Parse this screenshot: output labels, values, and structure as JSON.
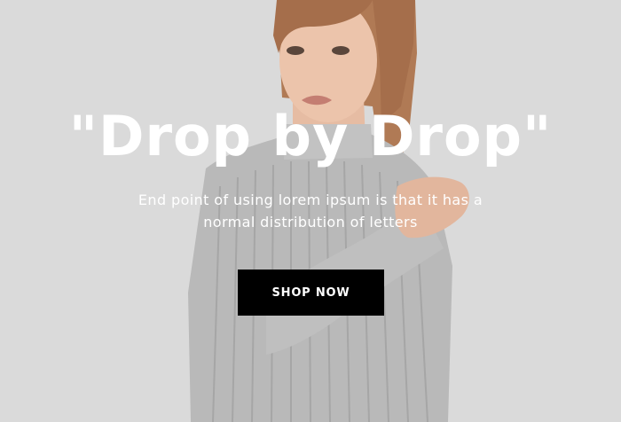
{
  "hero": {
    "title": "\"Drop by Drop\"",
    "subtitle": "End point of using lorem ipsum is that it has a normal distribution of letters",
    "cta_label": "SHOP NOW"
  },
  "colors": {
    "background": "#dadada",
    "text": "#ffffff",
    "button_bg": "#000000",
    "button_text": "#ffffff"
  }
}
